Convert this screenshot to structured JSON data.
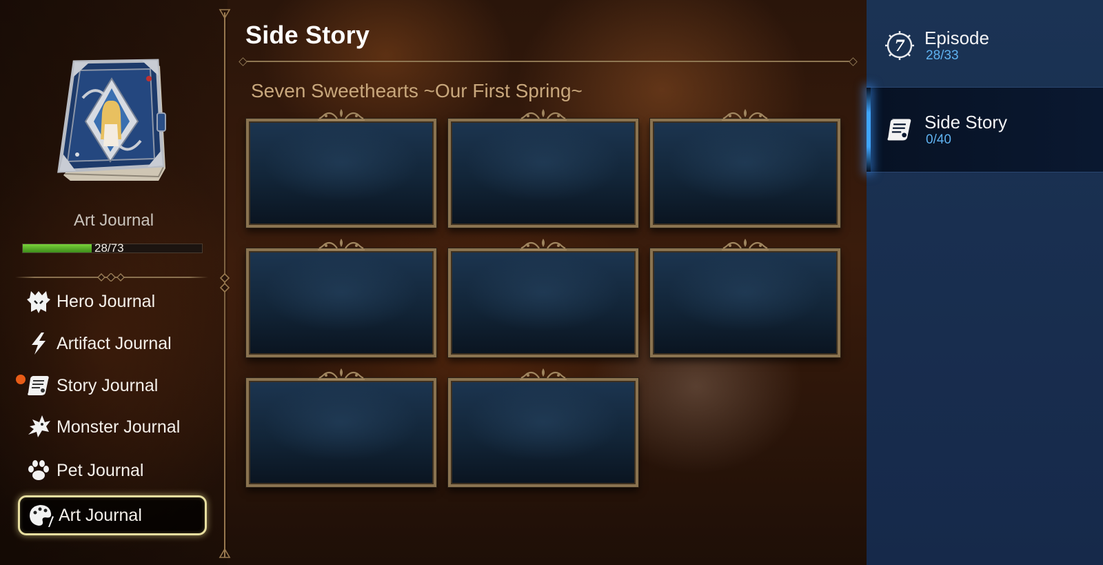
{
  "sidebar": {
    "journal_title": "Art Journal",
    "progress": {
      "current": 28,
      "total": 73,
      "text": "28/73",
      "fraction": 0.3836
    },
    "nav": [
      {
        "label": "Hero Journal",
        "icon": "hero-helmet-icon",
        "active": false,
        "badge": false
      },
      {
        "label": "Artifact Journal",
        "icon": "lightning-icon",
        "active": false,
        "badge": false
      },
      {
        "label": "Story Journal",
        "icon": "scroll-icon",
        "active": false,
        "badge": true
      },
      {
        "label": "Monster Journal",
        "icon": "dragon-icon",
        "active": false,
        "badge": false
      },
      {
        "label": "Pet Journal",
        "icon": "paw-icon",
        "active": false,
        "badge": false
      },
      {
        "label": "Art Journal",
        "icon": "palette-icon",
        "active": true,
        "badge": false
      }
    ]
  },
  "main": {
    "page_title": "Side Story",
    "section_title": "Seven Sweethearts ~Our First Spring~",
    "art_slots": [
      {
        "state": "locked"
      },
      {
        "state": "locked"
      },
      {
        "state": "locked"
      },
      {
        "state": "locked"
      },
      {
        "state": "locked"
      },
      {
        "state": "locked"
      },
      {
        "state": "locked"
      },
      {
        "state": "locked"
      }
    ]
  },
  "right_panel": {
    "items": [
      {
        "name": "Episode",
        "count": "28/33",
        "icon": "episode-7-icon",
        "selected": false
      },
      {
        "name": "Side Story",
        "count": "0/40",
        "icon": "scroll-icon",
        "selected": true
      }
    ]
  },
  "colors": {
    "accent_blue": "#5fb2f0",
    "progress_green": "#7ad23a",
    "frame_gold": "#8a7350",
    "badge_orange": "#e85c17",
    "active_outline": "#e8dfa0"
  }
}
